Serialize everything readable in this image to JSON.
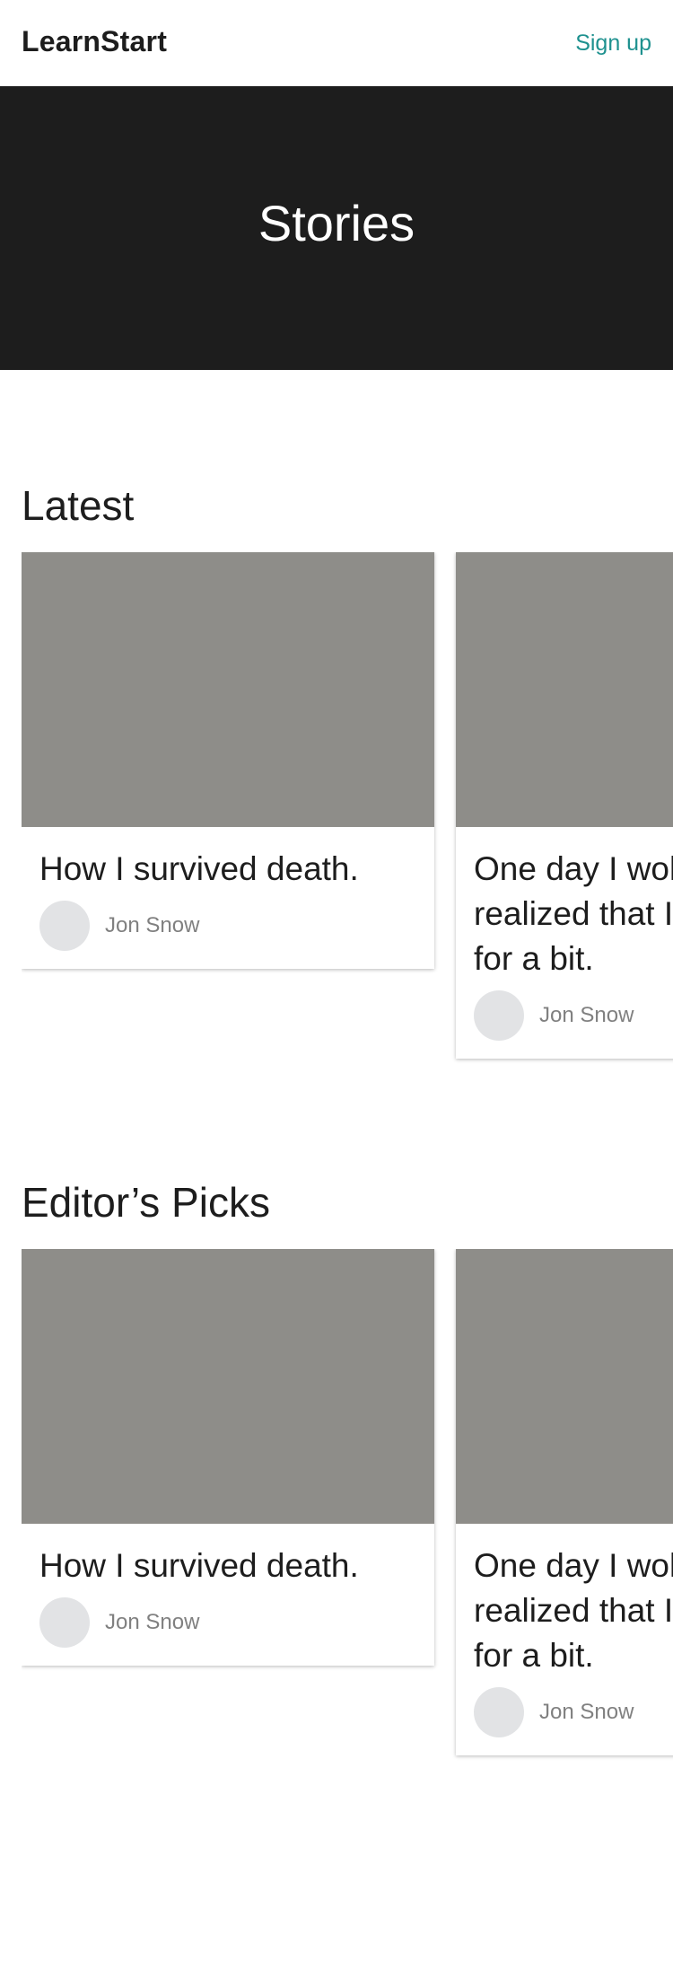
{
  "header": {
    "brand": "LearnStart",
    "signup_label": "Sign up"
  },
  "hero": {
    "title": "Stories"
  },
  "sections": [
    {
      "title": "Latest",
      "cards": [
        {
          "title": "How I survived death.",
          "author": "Jon Snow"
        },
        {
          "title": "One day I woke up and realized that I was dead for a bit.",
          "author": "Jon Snow"
        }
      ]
    },
    {
      "title": "Editor’s Picks",
      "cards": [
        {
          "title": "How I survived death.",
          "author": "Jon Snow"
        },
        {
          "title": "One day I woke up and realized that I was dead for a bit.",
          "author": "Jon Snow"
        }
      ]
    }
  ],
  "colors": {
    "accent": "#1e918f",
    "hero_background": "#1d1d1d",
    "image_placeholder": "#8e8d89",
    "avatar_placeholder": "#e2e3e5"
  }
}
